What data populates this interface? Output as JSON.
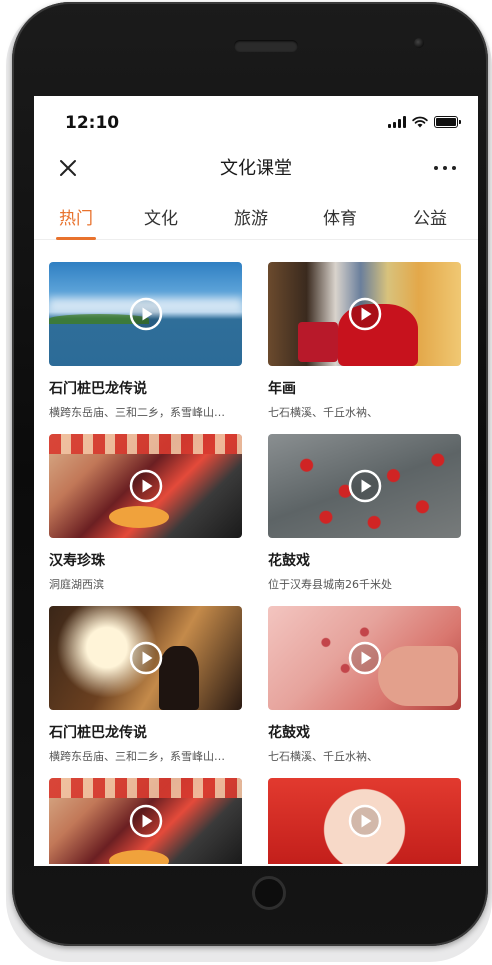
{
  "status_bar": {
    "time": "12:10"
  },
  "nav": {
    "title": "文化课堂"
  },
  "tabs": [
    {
      "label": "热门",
      "active": true
    },
    {
      "label": "文化",
      "active": false
    },
    {
      "label": "旅游",
      "active": false
    },
    {
      "label": "体育",
      "active": false
    },
    {
      "label": "公益",
      "active": false
    }
  ],
  "cards": [
    {
      "title": "石门桩巴龙传说",
      "subtitle": "横跨东岳庙、三和二乡，系雪峰山…",
      "icon": "play-icon"
    },
    {
      "title": "年画",
      "subtitle": "七石横溪、千丘水衲、",
      "icon": "play-icon"
    },
    {
      "title": "汉寿珍珠",
      "subtitle": "洞庭湖西滨",
      "icon": "play-icon"
    },
    {
      "title": "花鼓戏",
      "subtitle": "位于汉寿县城南26千米处",
      "icon": "play-icon"
    },
    {
      "title": "石门桩巴龙传说",
      "subtitle": "横跨东岳庙、三和二乡，系雪峰山…",
      "icon": "play-icon"
    },
    {
      "title": "花鼓戏",
      "subtitle": "七石横溪、千丘水衲、",
      "icon": "play-icon"
    }
  ],
  "colors": {
    "accent": "#e8722d",
    "text": "#1a1a1a",
    "subtext": "#555555"
  }
}
